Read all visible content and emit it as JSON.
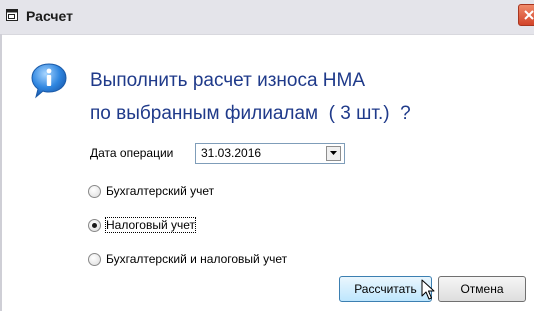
{
  "window": {
    "title": "Расчет"
  },
  "message": {
    "line1": "Выполнить расчет износа НМА",
    "line2": "по выбранным филиалам  ( 3 шт.)  ?"
  },
  "date": {
    "label": "Дата операции",
    "value": "31.03.2016"
  },
  "accounting": {
    "options": [
      {
        "label": "Бухгалтерский учет",
        "selected": false
      },
      {
        "label": "Налоговый учет",
        "selected": true
      },
      {
        "label": "Бухгалтерский и налоговый учет",
        "selected": false
      }
    ]
  },
  "buttons": {
    "calculate": "Рассчитать",
    "cancel": "Отмена"
  },
  "icons": {
    "title": "window-icon",
    "info": "info-icon",
    "close": "close-icon",
    "dropdown": "chevron-down-icon",
    "cursor": "mouse-cursor-icon"
  },
  "colors": {
    "message_text": "#1f3a8a",
    "close_button": "#d2442a",
    "primary_button": "#bee6fd"
  }
}
